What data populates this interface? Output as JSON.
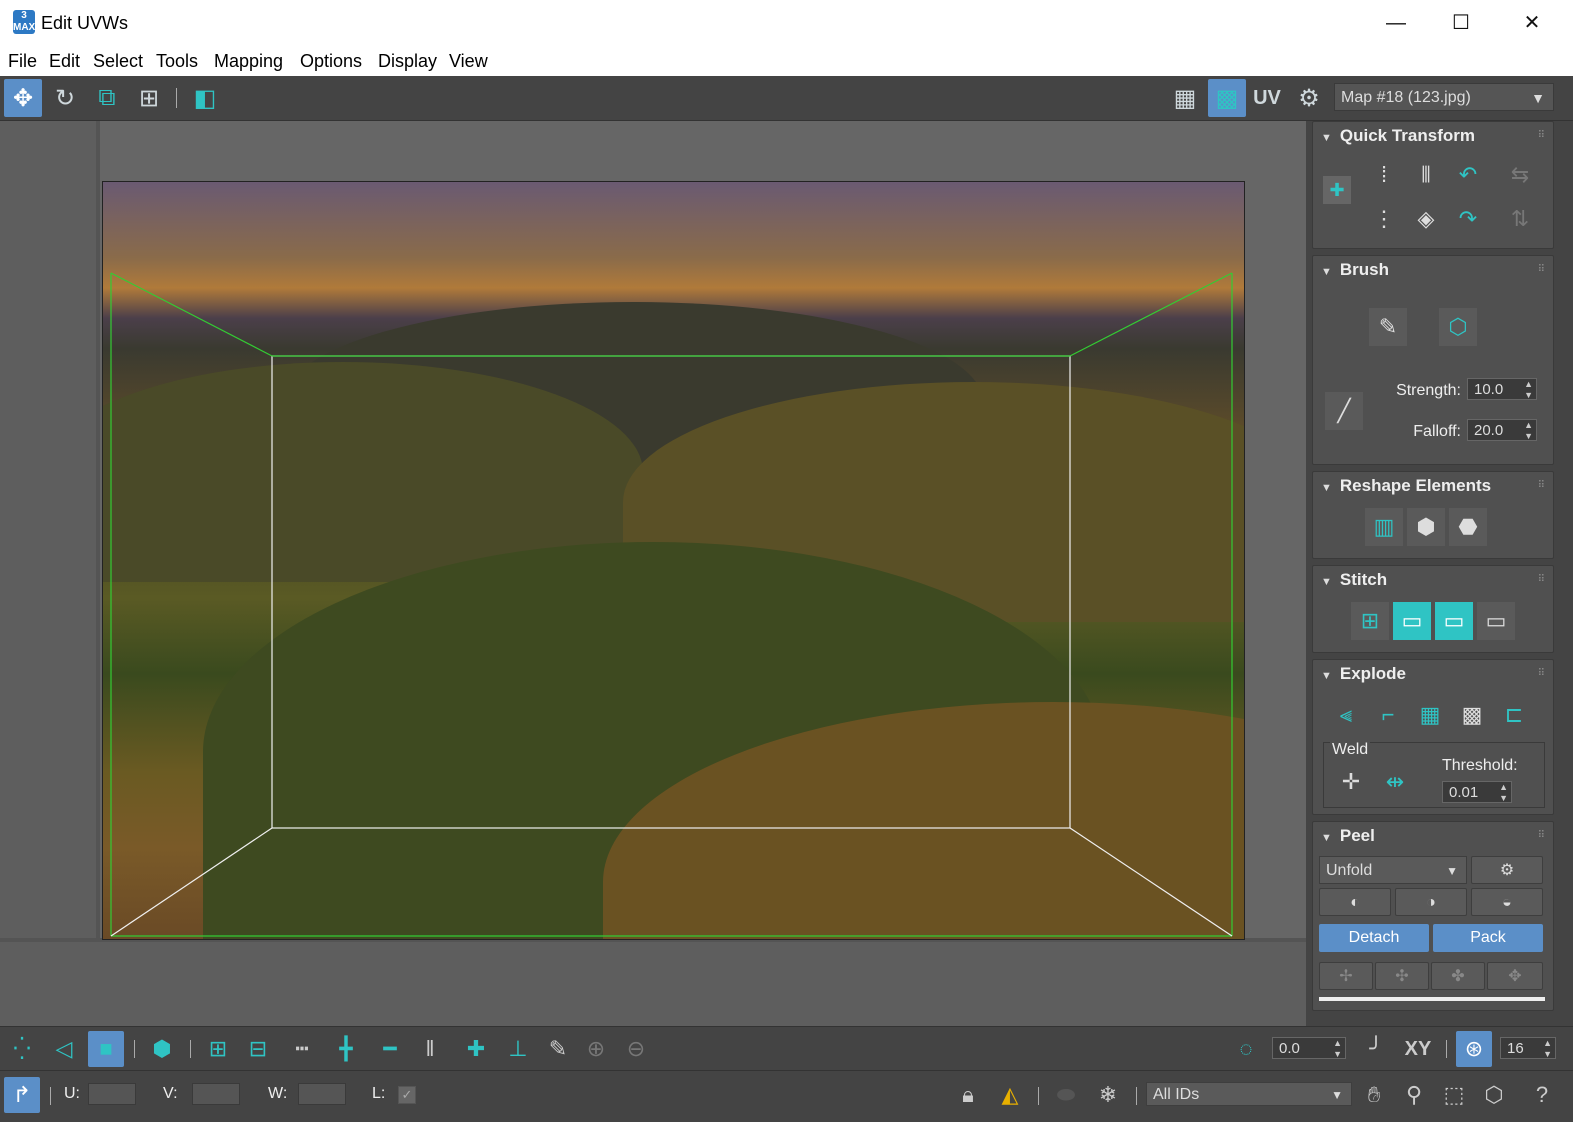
{
  "window": {
    "title": "Edit UVWs",
    "app_icon_text": "3\nMAX",
    "minimize": "—",
    "maximize": "☐",
    "close": "✕"
  },
  "menu": [
    "File",
    "Edit",
    "Select",
    "Tools",
    "Mapping",
    "Options",
    "Display",
    "View"
  ],
  "toolbar": {
    "uv_label": "UV",
    "map_selector": "Map #18 (123.jpg)"
  },
  "panel": {
    "quick_transform": {
      "title": "Quick Transform"
    },
    "brush": {
      "title": "Brush",
      "strength_label": "Strength:",
      "strength_value": "10.0",
      "falloff_label": "Falloff:",
      "falloff_value": "20.0"
    },
    "reshape": {
      "title": "Reshape Elements"
    },
    "stitch": {
      "title": "Stitch"
    },
    "explode": {
      "title": "Explode",
      "weld_label": "Weld",
      "threshold_label": "Threshold:",
      "threshold_value": "0.01"
    },
    "peel": {
      "title": "Peel",
      "mode": "Unfold",
      "detach": "Detach",
      "pack": "Pack"
    }
  },
  "bottom": {
    "angle_value": "0.0",
    "xy_label": "XY",
    "grid_value": "16",
    "u_label": "U:",
    "v_label": "V:",
    "w_label": "W:",
    "l_label": "L:",
    "ids_selector": "All IDs"
  },
  "colors": {
    "accent_blue": "#5b8fc8",
    "teal_icon": "#2fc4c4",
    "green_guide": "#33cc33",
    "panel_bg": "#505050"
  }
}
